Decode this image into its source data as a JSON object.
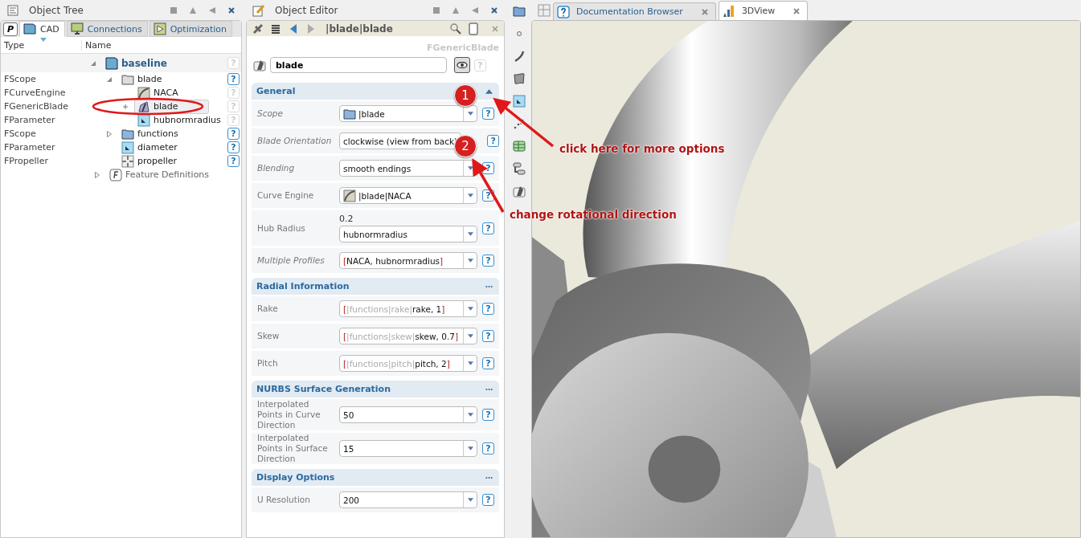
{
  "object_tree": {
    "title": "Object Tree",
    "p_button": "P",
    "tabs": [
      {
        "label": "CAD",
        "selected": true
      },
      {
        "label": "Connections",
        "selected": false
      },
      {
        "label": "Optimization",
        "selected": false
      }
    ],
    "columns": [
      "Type",
      "Name"
    ],
    "nodes": [
      {
        "name": "baseline",
        "kind": "cad",
        "expanded": true,
        "selected": false,
        "help": {
          "label": "?",
          "enabled": false
        },
        "children": [
          {
            "type": "FScope",
            "name": "blade",
            "kind": "scope",
            "expanded": true,
            "selected": false,
            "help": {
              "label": "?",
              "enabled": true
            },
            "children": [
              {
                "type": "FCurveEngine",
                "name": "NACA",
                "kind": "curve",
                "selected": false,
                "help": {
                  "label": "?",
                  "enabled": false
                }
              },
              {
                "type": "FGenericBlade",
                "name": "blade",
                "kind": "blade",
                "plus": true,
                "selected": true,
                "help": {
                  "label": "?",
                  "enabled": false
                }
              },
              {
                "type": "FParameter",
                "name": "hubnormradius",
                "kind": "parameter",
                "selected": false,
                "help": {
                  "label": "?",
                  "enabled": false
                }
              }
            ]
          },
          {
            "type": "FScope",
            "name": "functions",
            "kind": "folder",
            "expanded": false,
            "selected": false,
            "help": {
              "label": "?",
              "enabled": true
            }
          },
          {
            "type": "FParameter",
            "name": "diameter",
            "kind": "parameter",
            "selected": false,
            "help": {
              "label": "?",
              "enabled": true
            }
          },
          {
            "type": "FPropeller",
            "name": "propeller",
            "kind": "propeller",
            "selected": false,
            "help": {
              "label": "?",
              "enabled": true
            }
          }
        ]
      },
      {
        "name": "Feature Definitions",
        "kind": "feature",
        "expanded": false,
        "selected": false
      }
    ]
  },
  "object_editor": {
    "title": "Object Editor",
    "path": "|blade|blade",
    "class_name": "FGenericBlade",
    "name_value": "blade",
    "help": {
      "label": "?",
      "enabled": false
    },
    "sections": [
      {
        "title": "General",
        "options_expanded": true,
        "rows": [
          {
            "label": "Scope",
            "italic": true,
            "kind": "scope",
            "parts": [
              {
                "text": "|blade"
              }
            ],
            "help": {
              "label": "?",
              "enabled": true
            }
          },
          {
            "label": "Blade Orientation",
            "italic": true,
            "kind": "text",
            "parts": [
              {
                "text": "clockwise (view from back)"
              }
            ],
            "help": {
              "label": "?",
              "enabled": true
            }
          },
          {
            "label": "Blending",
            "italic": true,
            "kind": "combo",
            "parts": [
              {
                "text": "smooth endings"
              }
            ],
            "help": {
              "label": "?",
              "enabled": true
            }
          },
          {
            "label": "Curve Engine",
            "italic": false,
            "kind": "curve",
            "parts": [
              {
                "text": "|blade|NACA"
              }
            ],
            "help": {
              "label": "?",
              "enabled": true
            }
          },
          {
            "label": "Hub Radius",
            "italic": false,
            "kind": "combo",
            "hint": "0.2",
            "parts": [
              {
                "text": "hubnormradius"
              }
            ],
            "help": {
              "label": "?",
              "enabled": true
            }
          },
          {
            "label": "Multiple Profiles",
            "italic": true,
            "kind": "combo",
            "parts": [
              {
                "text": "[",
                "marked": true
              },
              {
                "text": "NACA, hubnormradius"
              },
              {
                "text": "]",
                "marked": true
              }
            ],
            "help": {
              "label": "?",
              "enabled": true
            }
          }
        ]
      },
      {
        "title": "Radial Information",
        "options_expanded": false,
        "rows": [
          {
            "label": "Rake",
            "italic": false,
            "kind": "combo",
            "parts": [
              {
                "text": "[",
                "marked": true
              },
              {
                "text": "|functions|rake|",
                "muted": true
              },
              {
                "text": "rake, 1"
              },
              {
                "text": "]",
                "marked": true
              }
            ],
            "help": {
              "label": "?",
              "enabled": true
            }
          },
          {
            "label": "Skew",
            "italic": false,
            "kind": "combo",
            "parts": [
              {
                "text": "[",
                "marked": true
              },
              {
                "text": "|functions|skew|",
                "muted": true
              },
              {
                "text": "skew, 0.7"
              },
              {
                "text": "]",
                "marked": true
              }
            ],
            "help": {
              "label": "?",
              "enabled": true
            }
          },
          {
            "label": "Pitch",
            "italic": false,
            "kind": "combo",
            "parts": [
              {
                "text": "[",
                "marked": true
              },
              {
                "text": "|functions|pitch|",
                "muted": true
              },
              {
                "text": "pitch, 2"
              },
              {
                "text": "]",
                "marked": true
              }
            ],
            "help": {
              "label": "?",
              "enabled": true
            }
          }
        ]
      },
      {
        "title": "NURBS Surface Generation",
        "options_expanded": false,
        "rows": [
          {
            "label": "Interpolated Points in Curve Direction",
            "italic": false,
            "kind": "combo",
            "parts": [
              {
                "text": "50"
              }
            ],
            "help": {
              "label": "?",
              "enabled": true
            }
          },
          {
            "label": "Interpolated Points in Surface Direction",
            "italic": false,
            "kind": "combo",
            "parts": [
              {
                "text": "15"
              }
            ],
            "help": {
              "label": "?",
              "enabled": true
            }
          }
        ]
      },
      {
        "title": "Display Options",
        "options_expanded": false,
        "rows": [
          {
            "label": "U Resolution",
            "italic": false,
            "kind": "combo",
            "parts": [
              {
                "text": "200"
              }
            ],
            "help": {
              "label": "?",
              "enabled": true
            }
          }
        ]
      }
    ]
  },
  "view_tabs": [
    {
      "label": "Documentation Browser",
      "selected": false
    },
    {
      "label": "3DView",
      "selected": true
    }
  ],
  "callouts": [
    {
      "number": "1",
      "text": "click here for more options"
    },
    {
      "number": "2",
      "text": "change rotational direction"
    }
  ]
}
